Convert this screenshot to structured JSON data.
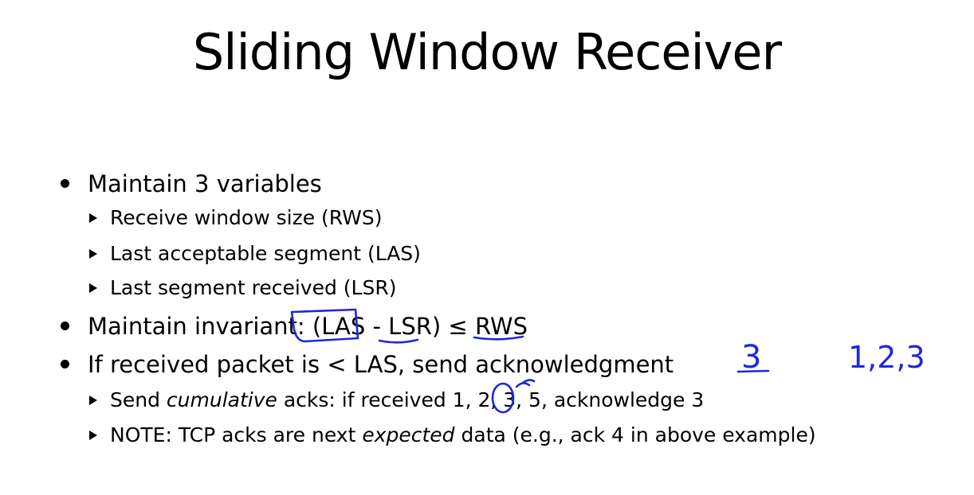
{
  "slide": {
    "title": "Sliding Window Receiver"
  },
  "bullets": [
    {
      "text": "Maintain 3 variables",
      "sub": [
        {
          "text": "Receive window size (RWS)"
        },
        {
          "text": "Last acceptable segment (LAS)"
        },
        {
          "text": "Last segment received (LSR)"
        }
      ]
    },
    {
      "text_prefix": "Maintain invariant:",
      "text_formula": "(LAS - LSR) ≤ RWS"
    },
    {
      "text": "If received packet is < LAS,  send acknowledgment",
      "sub": [
        {
          "pre": "Send ",
          "em": "cumulative",
          "post": " acks: if received 1, 2, 3, 5, acknowledge 3"
        },
        {
          "pre": "NOTE: TCP acks are next ",
          "em": "expected",
          "post": " data (e.g., ack 4 in above example)"
        }
      ]
    }
  ],
  "annotations": {
    "handwritten_ack": "3",
    "handwritten_sequence": "1,2,3"
  },
  "colors": {
    "ink": "#1f27d8",
    "text": "#000000",
    "background": "#ffffff"
  }
}
